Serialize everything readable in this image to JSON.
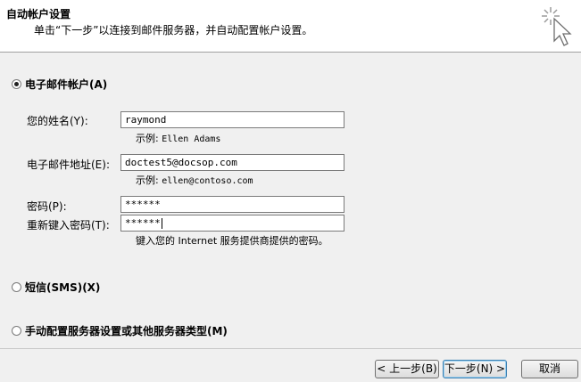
{
  "header": {
    "title": "自动帐户设置",
    "subtitle": "单击“下一步”以连接到邮件服务器，并自动配置帐户设置。"
  },
  "options": {
    "email_account": "电子邮件帐户(A)",
    "sms": "短信(SMS)(X)",
    "manual": "手动配置服务器设置或其他服务器类型(M)"
  },
  "form": {
    "name_label": "您的姓名(Y):",
    "name_value": "raymond",
    "name_hint_prefix": "示例: ",
    "name_hint_example": "Ellen Adams",
    "email_label": "电子邮件地址(E):",
    "email_value": "doctest5@docsop.com",
    "email_hint_prefix": "示例: ",
    "email_hint_example": "ellen@contoso.com",
    "password_label": "密码(P):",
    "password_value": "******",
    "retype_label": "重新键入密码(T):",
    "retype_value": "******",
    "password_hint": "键入您的 Internet 服务提供商提供的密码。"
  },
  "buttons": {
    "back": "< 上一步(B)",
    "next": "下一步(N) >",
    "cancel": "取消"
  },
  "icons": {
    "wand": "magic-wand-cursor-icon"
  }
}
